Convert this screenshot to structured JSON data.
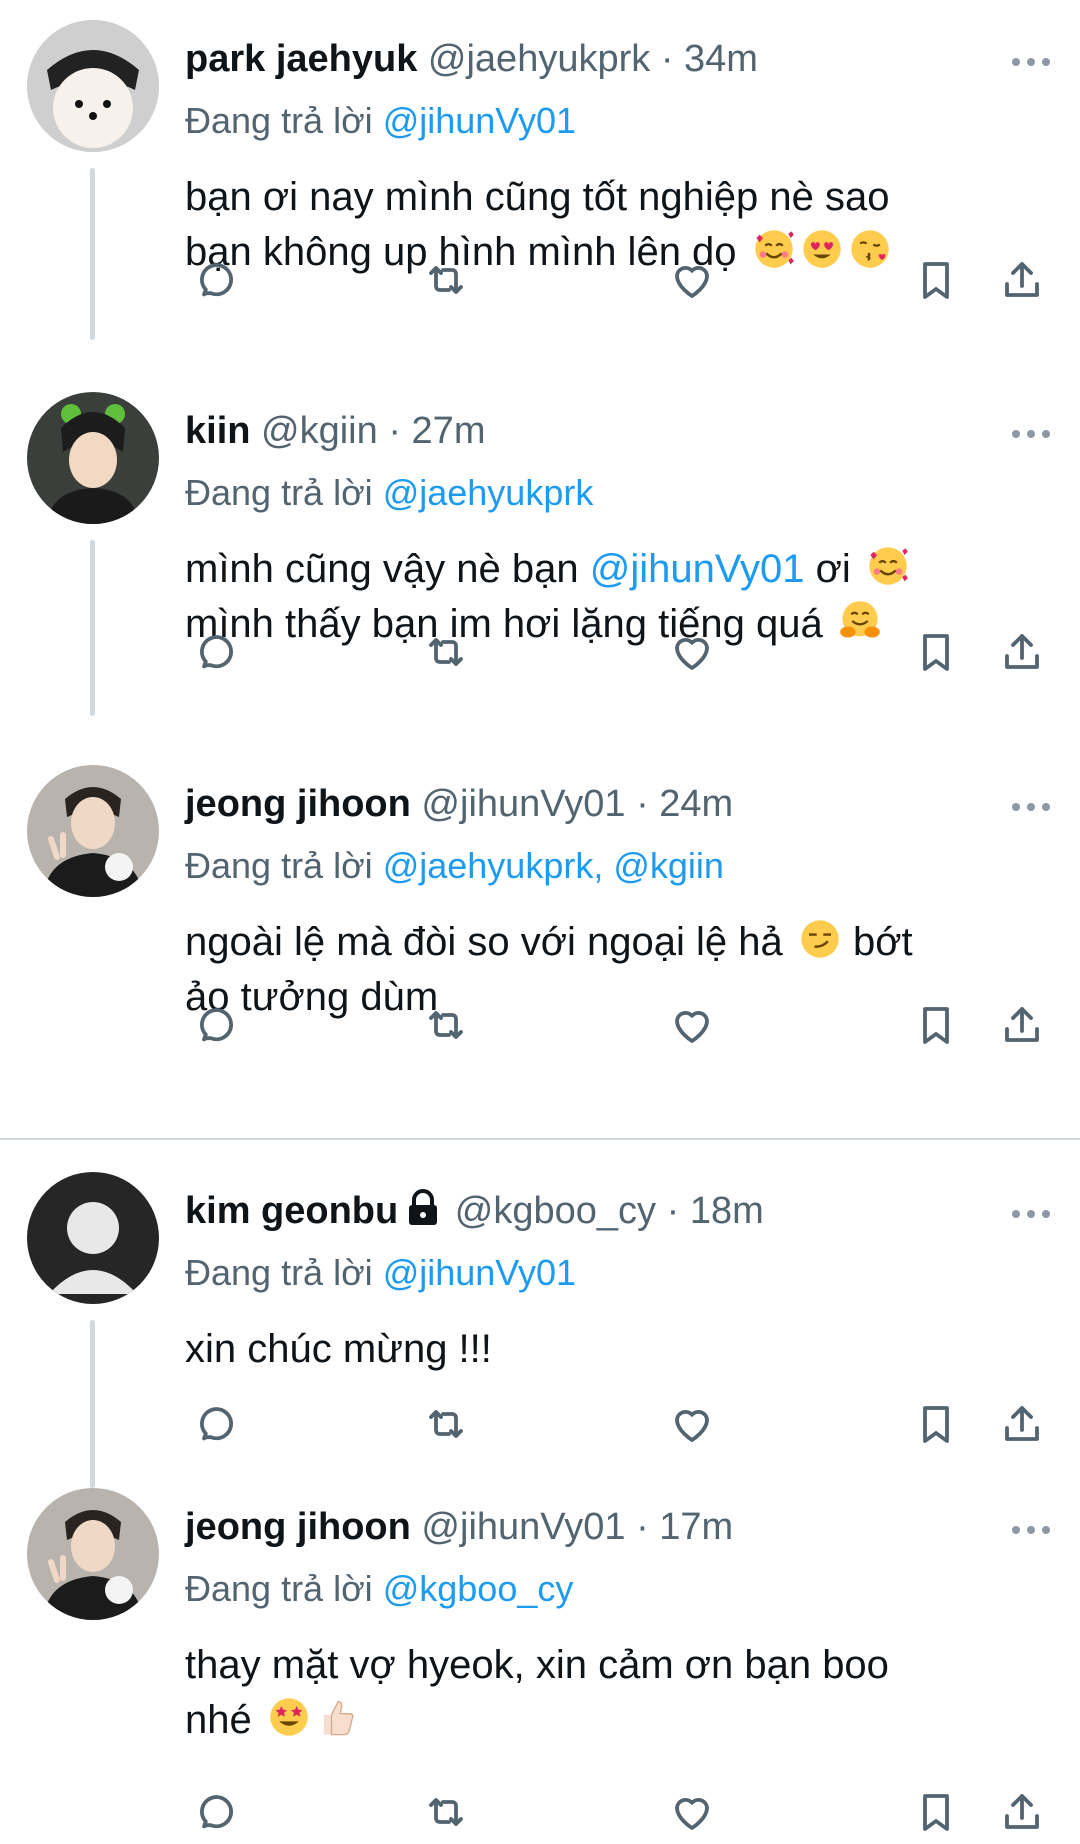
{
  "colors": {
    "accent": "#1d9bf0",
    "muted": "#536471",
    "text": "#0f1419",
    "line": "#cfd9de"
  },
  "tweets": [
    {
      "name": "park jaehyuk",
      "handle": "@jaehyukprk",
      "dot": "·",
      "time": "34m",
      "reply_prefix": "Đang trả lời",
      "reply_to": "@jihunVy01",
      "lines": [
        "bạn ơi nay mình cũng tốt nghiệp nè sao",
        "bạn không up hình mình lên dọ"
      ],
      "emojis": [
        "smiling-face-with-hearts",
        "heart-eyes",
        "face-blowing-kiss"
      ]
    },
    {
      "name": "kiin",
      "handle": "@kgiin",
      "dot": "·",
      "time": "27m",
      "reply_prefix": "Đang trả lời",
      "reply_to": "@jaehyukprk",
      "line1_pre": "mình cũng vậy nè bạn ",
      "line1_mention": "@jihunVy01",
      "line1_post": " ơi",
      "line2": "mình thấy bạn im hơi lặng tiếng quá",
      "emojis": [
        "smiling-face-with-hearts",
        "hugging-face"
      ]
    },
    {
      "name": "jeong jihoon",
      "handle": "@jihunVy01",
      "dot": "·",
      "time": "24m",
      "reply_prefix": "Đang trả lời",
      "reply_to": "@jaehyukprk, @kgiin",
      "line1_pre": "ngoài lệ mà đòi so với ngoại lệ hả",
      "line1_post": "bớt",
      "line2": "ảo tưởng dùm",
      "emojis": [
        "smirking-face"
      ]
    },
    {
      "name": "kim geonbu",
      "handle": "@kgboo_cy",
      "dot": "·",
      "time": "18m",
      "reply_prefix": "Đang trả lời",
      "reply_to": "@jihunVy01",
      "line1": "xin chúc mừng !!!",
      "locked": true
    },
    {
      "name": "jeong jihoon",
      "handle": "@jihunVy01",
      "dot": "·",
      "time": "17m",
      "reply_prefix": "Đang trả lời",
      "reply_to": "@kgboo_cy",
      "line1": "thay mặt vợ hyeok, xin cảm ơn bạn boo",
      "line2": "nhé",
      "emojis": [
        "star-struck",
        "thumbs-up"
      ]
    }
  ],
  "action_icons": [
    "reply-icon",
    "retweet-icon",
    "like-icon",
    "bookmark-icon",
    "share-icon"
  ]
}
